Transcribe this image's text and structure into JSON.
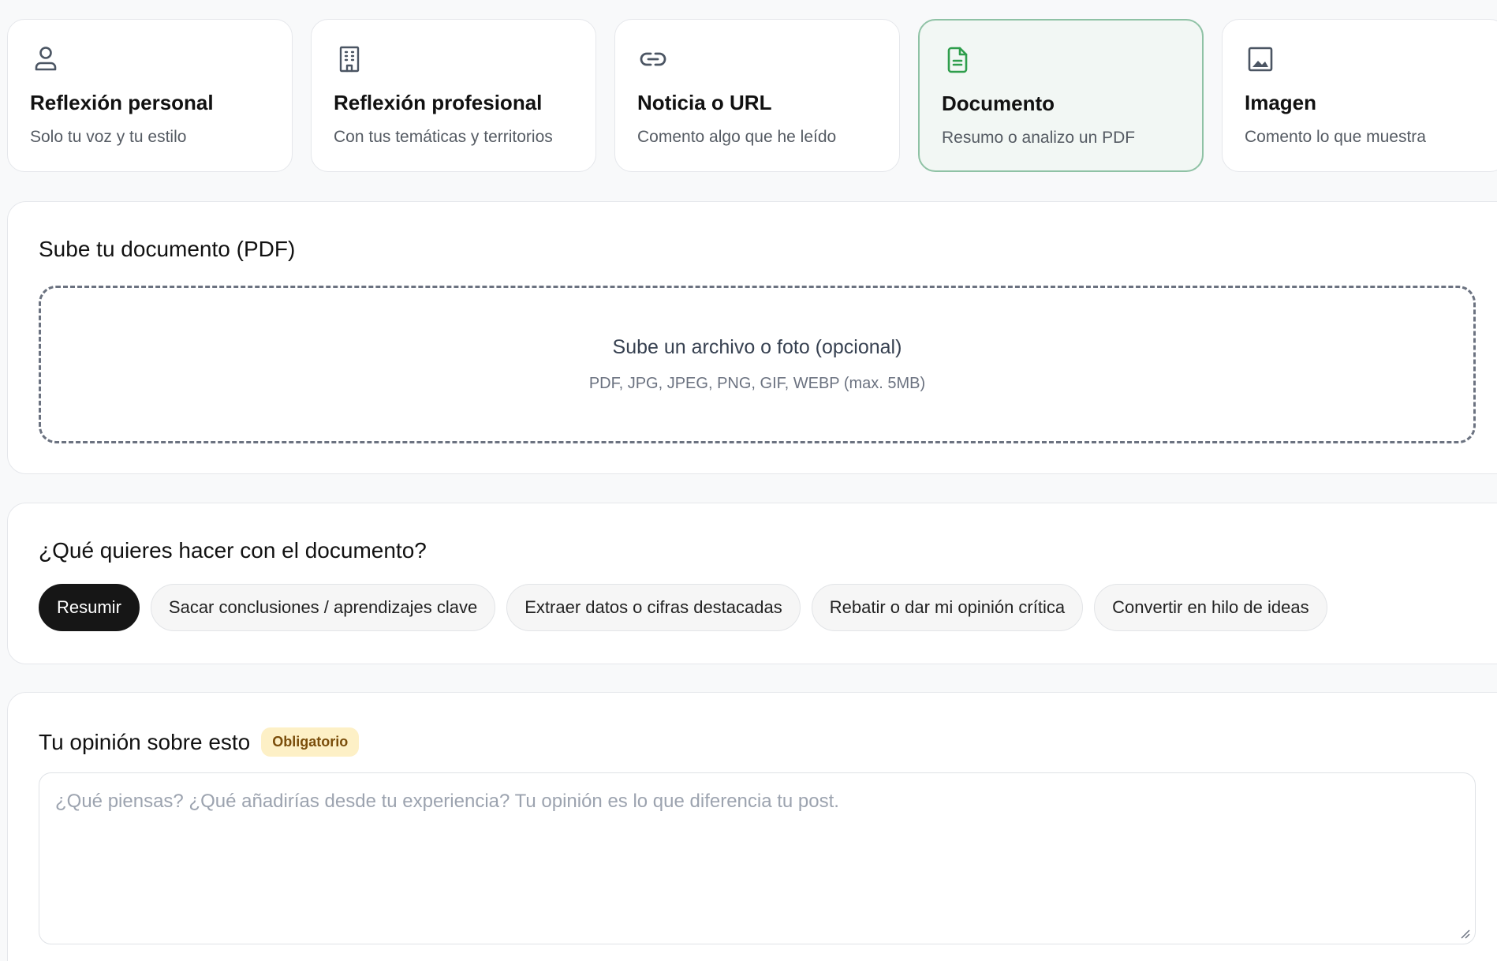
{
  "modes": [
    {
      "title": "Reflexión personal",
      "subtitle": "Solo tu voz y tu estilo",
      "icon": "person-icon",
      "active": false
    },
    {
      "title": "Reflexión profesional",
      "subtitle": "Con tus temáticas y territorios",
      "icon": "building-icon",
      "active": false
    },
    {
      "title": "Noticia o URL",
      "subtitle": "Comento algo que he leído",
      "icon": "link-icon",
      "active": false
    },
    {
      "title": "Documento",
      "subtitle": "Resumo o analizo un PDF",
      "icon": "document-icon",
      "active": true
    },
    {
      "title": "Imagen",
      "subtitle": "Comento lo que muestra",
      "icon": "image-icon",
      "active": false
    }
  ],
  "upload": {
    "title": "Sube tu documento (PDF)",
    "dropzone_main": "Sube un archivo o foto (opcional)",
    "dropzone_sub": "PDF, JPG, JPEG, PNG, GIF, WEBP (max. 5MB)"
  },
  "actions": {
    "title": "¿Qué quieres hacer con el documento?",
    "options": [
      {
        "label": "Resumir",
        "active": true
      },
      {
        "label": "Sacar conclusiones / aprendizajes clave",
        "active": false
      },
      {
        "label": "Extraer datos o cifras destacadas",
        "active": false
      },
      {
        "label": "Rebatir o dar mi opinión crítica",
        "active": false
      },
      {
        "label": "Convertir en hilo de ideas",
        "active": false
      }
    ]
  },
  "opinion": {
    "title": "Tu opinión sobre esto",
    "badge": "Obligatorio",
    "placeholder": "¿Qué piensas? ¿Qué añadirías desde tu experiencia? Tu opinión es lo que diferencia tu post."
  },
  "colors": {
    "active_accent": "#2f9e4c",
    "active_border": "#8fc2a5",
    "active_bg": "#f2f7f4",
    "chip_active": "#161616",
    "badge_bg": "#fdf0c6",
    "badge_text": "#7a4d0a"
  }
}
